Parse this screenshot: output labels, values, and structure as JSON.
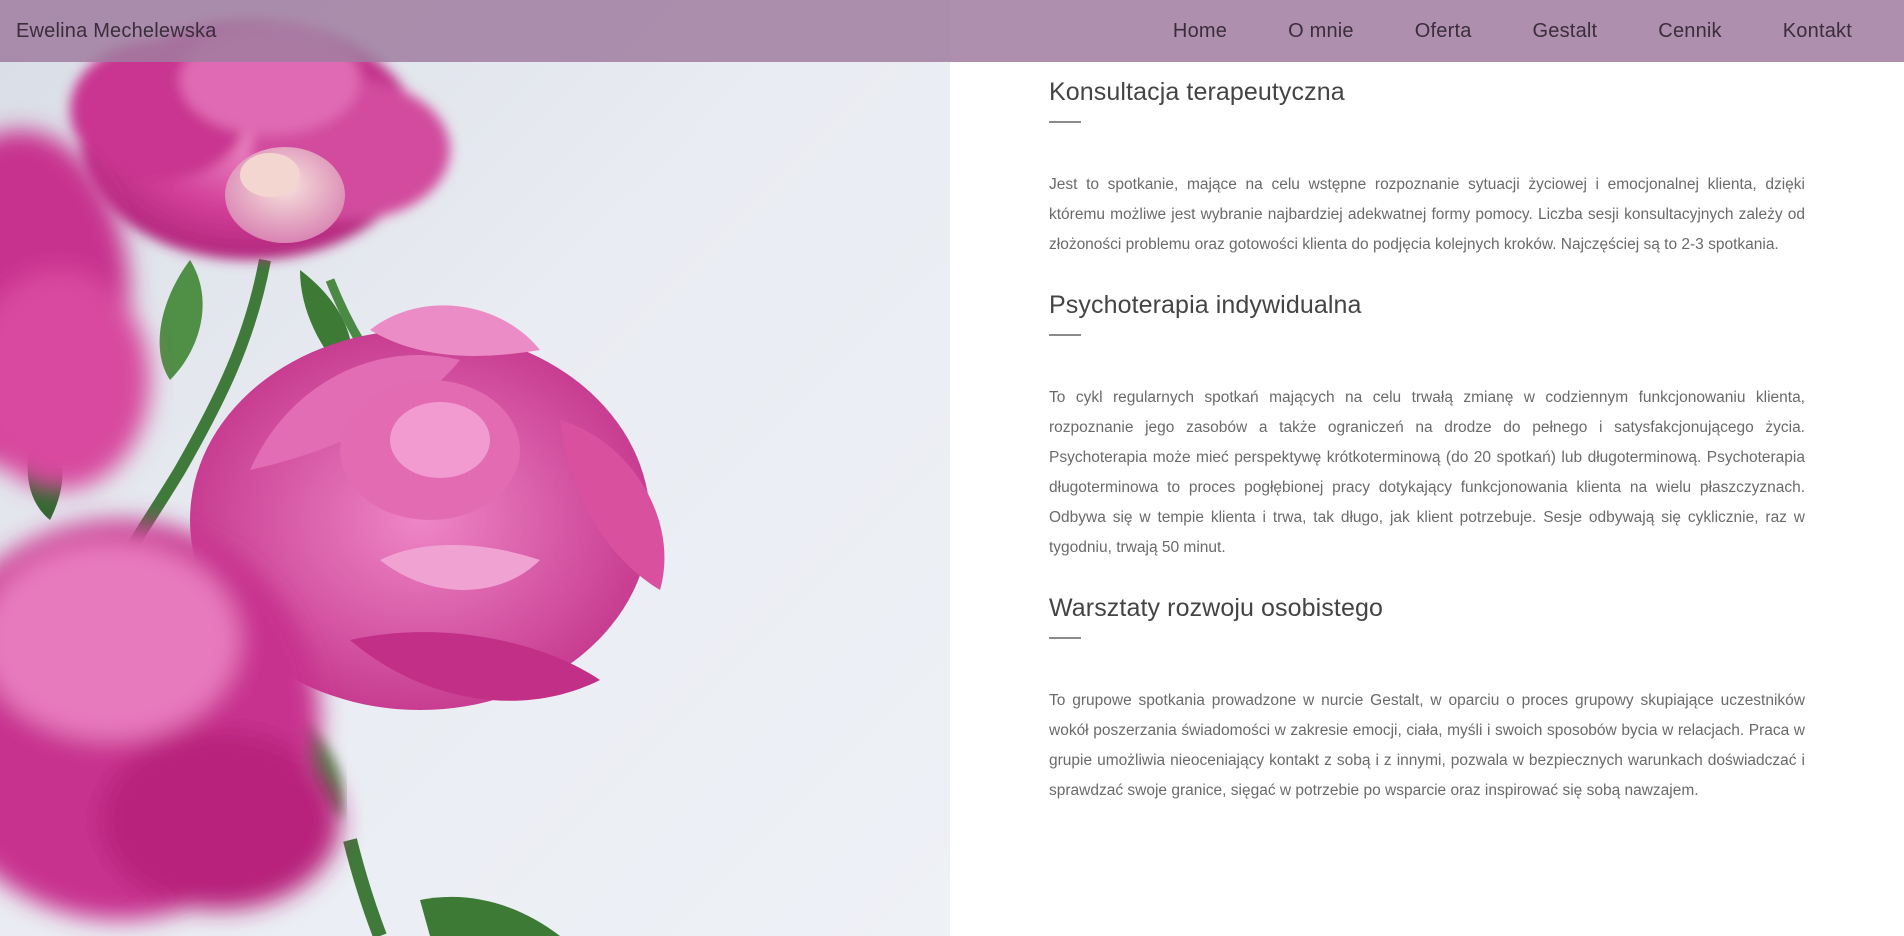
{
  "header": {
    "brand": "Ewelina Mechelewska",
    "nav": [
      "Home",
      "O mnie",
      "Oferta",
      "Gestalt",
      "Cennik",
      "Kontakt"
    ]
  },
  "hero": {
    "image_subject": "pink peony flowers on light background",
    "colors": {
      "petal": "#c8328f",
      "petal_light": "#e46bb6",
      "stem": "#3f7a3a",
      "background": "#e6e9ef"
    }
  },
  "sections": [
    {
      "title": "Konsultacja terapeutyczna",
      "text": "Jest to spotkanie, mające na celu wstępne rozpoznanie sytuacji życiowej i emocjonalnej klienta, dzięki któremu możliwe jest wybranie najbardziej adekwatnej formy pomocy. Liczba sesji konsultacyjnych zależy od złożoności problemu oraz gotowości klienta do podjęcia kolejnych kroków. Najczęściej są to 2-3 spotkania."
    },
    {
      "title": "Psychoterapia indywidualna",
      "text": "To cykl regularnych spotkań mających na celu trwałą zmianę w codziennym funkcjonowaniu klienta, rozpoznanie jego zasobów a także ograniczeń na drodze do pełnego i satysfakcjonującego życia. Psychoterapia może mieć perspektywę krótkoterminową (do 20 spotkań) lub długoterminową. Psychoterapia długoterminowa to proces pogłębionej pracy dotykający funkcjonowania klienta na wielu płaszczyznach. Odbywa się w tempie klienta i trwa, tak długo, jak klient potrzebuje. Sesje odbywają się cyklicznie, raz w tygodniu, trwają 50 minut."
    },
    {
      "title": "Warsztaty rozwoju osobistego",
      "text": "To grupowe spotkania prowadzone w nurcie Gestalt, w oparciu o proces grupowy skupiające uczestników wokół poszerzania świadomości w zakresie emocji, ciała, myśli i swoich sposobów bycia w relacjach. Praca w grupie umożliwia nieoceniający kontakt z sobą i z innymi, pozwala w bezpiecznych warunkach doświadczać i sprawdzać swoje granice, sięgać w potrzebie po wsparcie oraz inspirować się sobą nawzajem."
    }
  ]
}
